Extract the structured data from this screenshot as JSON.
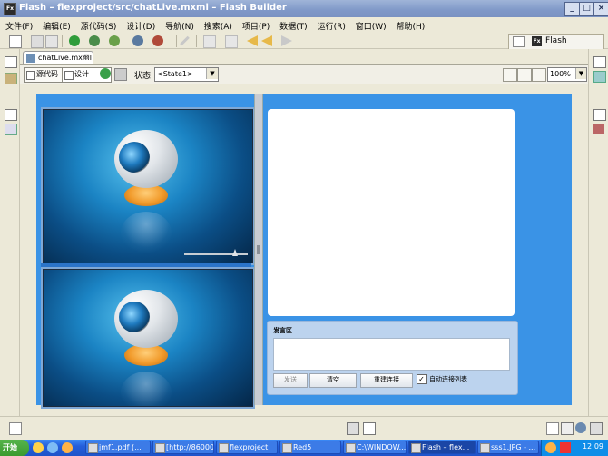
{
  "window": {
    "app_icon_text": "Fx",
    "title": "Flash – flexproject/src/chatLive.mxml – Flash Builder"
  },
  "menu": [
    "文件(F)",
    "编辑(E)",
    "源代码(S)",
    "设计(D)",
    "导航(N)",
    "搜索(A)",
    "项目(P)",
    "数据(T)",
    "运行(R)",
    "窗口(W)",
    "帮助(H)"
  ],
  "perspective": {
    "label": "Flash",
    "icon_text": "Fx"
  },
  "editor": {
    "tab_label": "chatLive.mxml",
    "source_button": "源代码",
    "design_button": "设计",
    "state_label": "状态:",
    "state_value": "<State1>",
    "zoom_value": "100%"
  },
  "chat": {
    "title": "发言区",
    "send_label": "发送",
    "clear_label": "清空",
    "reconnect_label": "重建连接",
    "auto_list_label": "自动连接列表",
    "auto_list_checked": true
  },
  "taskbar": {
    "start_label": "开始",
    "tasks": [
      "jmf1.pdf (...",
      "[http://86000...",
      "flexproject",
      "Red5",
      "C:\\WINDOW...",
      "Flash – flex...",
      "sss1.JPG - ..."
    ],
    "clock": "12:09"
  },
  "colors": {
    "app_bg": "#3a93e6",
    "title_bar": "#7f98c8",
    "taskbar": "#245edb"
  }
}
